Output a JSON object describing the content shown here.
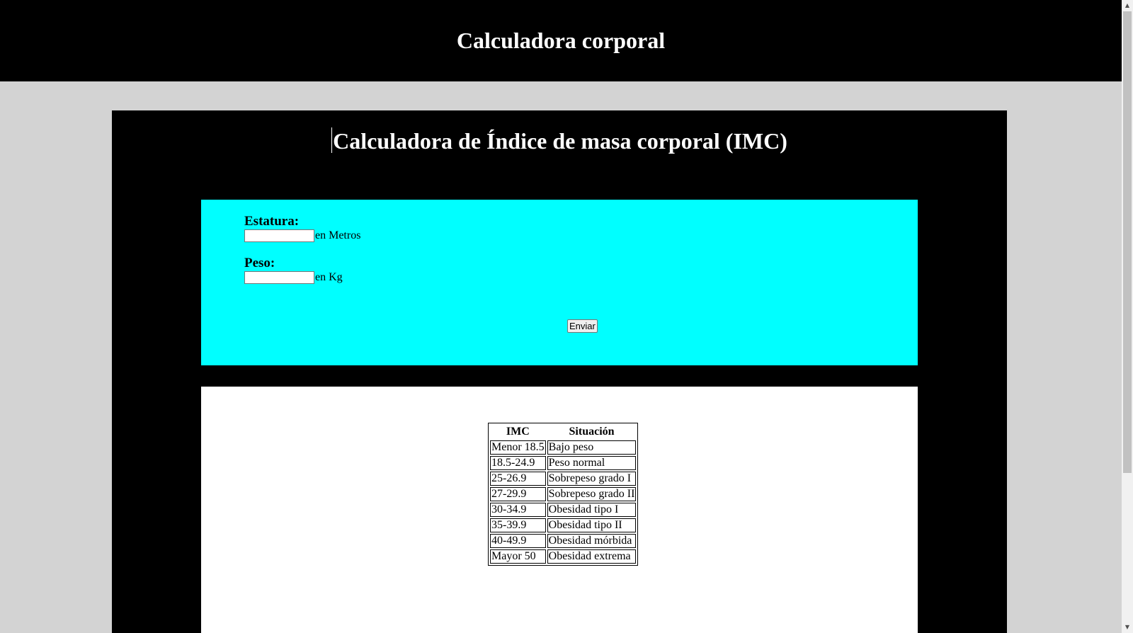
{
  "header": {
    "title": "Calculadora corporal"
  },
  "calculator": {
    "title": "Calculadora de Índice de masa corporal (IMC)",
    "height_label": "Estatura:",
    "height_unit": "en Metros",
    "height_value": "",
    "weight_label": "Peso:",
    "weight_unit": "en Kg",
    "weight_value": "",
    "submit_label": "Enviar"
  },
  "imc_table": {
    "headers": [
      "IMC",
      "Situación"
    ],
    "rows": [
      [
        "Menor 18.5",
        "Bajo peso"
      ],
      [
        "18.5-24.9",
        "Peso normal"
      ],
      [
        "25-26.9",
        "Sobrepeso grado I"
      ],
      [
        "27-29.9",
        "Sobrepeso grado II"
      ],
      [
        "30-34.9",
        "Obesidad tipo I"
      ],
      [
        "35-39.9",
        "Obesidad tipo II"
      ],
      [
        "40-49.9",
        "Obesidad mórbida"
      ],
      [
        "Mayor 50",
        "Obesidad extrema"
      ]
    ]
  },
  "colors": {
    "header_bg": "#000000",
    "page_bg": "#d3d3d3",
    "form_bg": "#00ffff",
    "table_bg": "#ffffff"
  },
  "icons": {
    "scroll_up": "scroll-up-arrow-icon",
    "scroll_down": "scroll-down-arrow-icon"
  }
}
